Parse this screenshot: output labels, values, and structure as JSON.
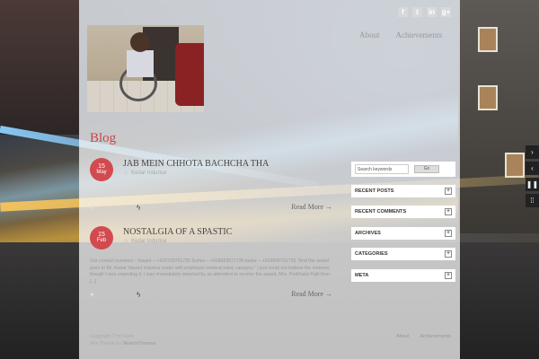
{
  "social": {
    "icons": [
      "facebook-icon",
      "twitter-icon",
      "linkedin-icon",
      "google-plus-icon"
    ],
    "glyphs": [
      "f",
      "t",
      "in",
      "g+"
    ]
  },
  "nav": {
    "about": "About",
    "achievements": "Achievements"
  },
  "blog": {
    "title": "Blog"
  },
  "posts": [
    {
      "day": "15",
      "month": "May",
      "title": "JAB MEIN CHHOTA BACHCHA THA",
      "author": "Kedar Indurkar",
      "excerpt": "",
      "read_more": "Read More →"
    },
    {
      "day": "15",
      "month": "Feb",
      "title": "NOSTALGIA OF A SPASTIC",
      "author": "Kedar Indurkar",
      "excerpt": "Our contact numbers : Vasant – +918793701735 Suhas – +918983071735 kedar – +919890701735 \"And the award goes to Mr. Kedar Vasant Indurkar under self employed cerebral palsy category.\" I just could not believe the moment, though I was expecting it. I was immediately wheeled by an attendent to receive the award. Mrs. Prabhatai Patil then [...]",
      "read_more": "Read More →"
    }
  ],
  "sidebar": {
    "search_placeholder": "Search keywords",
    "search_button": "Go",
    "widgets": [
      "RECENT POSTS",
      "RECENT COMMENTS",
      "ARCHIVES",
      "CATEGORIES",
      "META"
    ],
    "plus": "+"
  },
  "footer": {
    "copyright": "Copyright Tmn Here",
    "theme_prefix": "Ves Theme by",
    "theme_link": "SketchThemes",
    "nav_about": "About",
    "nav_achievements": "Achievements"
  },
  "slider_controls": [
    "›",
    "‹",
    "❚❚",
    "⁞⁞"
  ]
}
